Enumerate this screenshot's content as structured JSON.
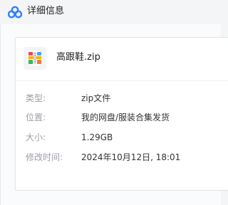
{
  "window": {
    "title": "详细信息",
    "logo_icon": "cloud-logo-icon"
  },
  "file": {
    "name": "高跟鞋.zip",
    "icon": "zip-archive-icon"
  },
  "details": [
    {
      "label": "类型:",
      "value": "zip文件"
    },
    {
      "label": "位置:",
      "value": "我的网盘/服装合集发货"
    },
    {
      "label": "大小:",
      "value": "1.29GB"
    },
    {
      "label": "修改时间:",
      "value": "2024年10月12日, 18:01"
    }
  ],
  "colors": {
    "logo_blue": "#2f80ff",
    "label_gray": "#9a9ea5",
    "text": "#333333"
  }
}
